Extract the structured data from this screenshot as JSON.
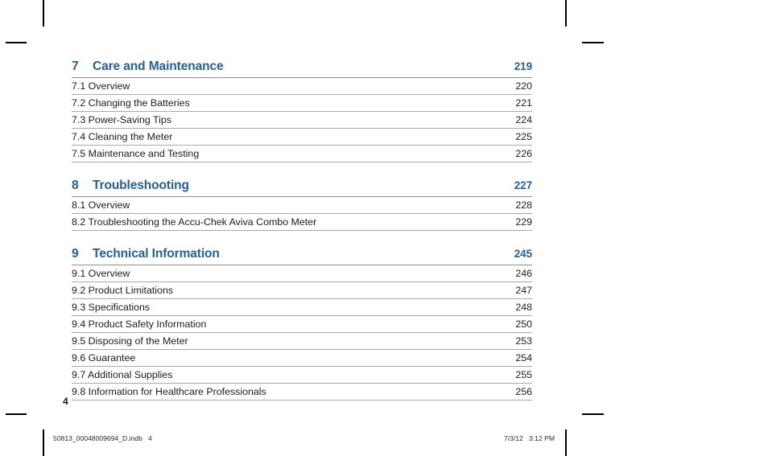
{
  "document": {
    "folio": "4"
  },
  "colors": {
    "heading_blue": "#235FA3",
    "body_text": "#1b1b1b",
    "rule_gray": "#a8a8a8"
  },
  "toc": {
    "sections": [
      {
        "number": "7",
        "title": "Care and Maintenance",
        "page": "219",
        "entries": [
          {
            "label": "7.1 Overview",
            "page": "220"
          },
          {
            "label": "7.2 Changing the Batteries",
            "page": "221"
          },
          {
            "label": "7.3 Power-Saving Tips",
            "page": "224"
          },
          {
            "label": "7.4 Cleaning the Meter",
            "page": "225"
          },
          {
            "label": "7.5 Maintenance and Testing",
            "page": "226"
          }
        ]
      },
      {
        "number": "8",
        "title": "Troubleshooting",
        "page": "227",
        "entries": [
          {
            "label": "8.1 Overview",
            "page": "228"
          },
          {
            "label": "8.2 Troubleshooting the Accu-Chek Aviva Combo Meter",
            "page": "229"
          }
        ]
      },
      {
        "number": "9",
        "title": "Technical Information",
        "page": "245",
        "entries": [
          {
            "label": "9.1 Overview",
            "page": "246"
          },
          {
            "label": "9.2 Product Limitations",
            "page": "247"
          },
          {
            "label": "9.3 Specifications",
            "page": "248"
          },
          {
            "label": "9.4 Product Safety Information",
            "page": "250"
          },
          {
            "label": "9.5 Disposing of the Meter",
            "page": "253"
          },
          {
            "label": "9.6 Guarantee",
            "page": "254"
          },
          {
            "label": "9.7 Additional Supplies",
            "page": "255"
          },
          {
            "label": "9.8 Information for Healthcare Professionals",
            "page": "256"
          }
        ]
      }
    ]
  },
  "print_footer": {
    "left": "50813_00048009694_D.indb   4",
    "right": "7/3/12   3:12 PM"
  }
}
